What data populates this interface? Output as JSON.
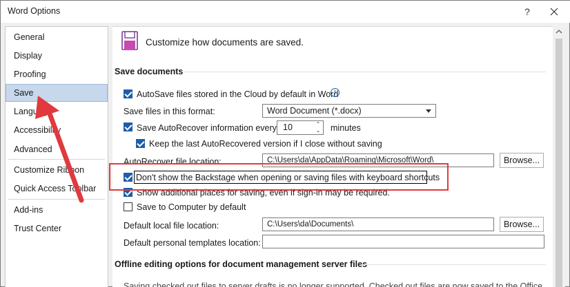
{
  "window": {
    "title": "Word Options",
    "help": "?"
  },
  "sidebar": {
    "items": [
      {
        "label": "General"
      },
      {
        "label": "Display"
      },
      {
        "label": "Proofing"
      },
      {
        "label": "Save"
      },
      {
        "label": "Language"
      },
      {
        "label": "Accessibility"
      },
      {
        "label": "Advanced"
      },
      {
        "label": "Customize Ribbon"
      },
      {
        "label": "Quick Access Toolbar"
      },
      {
        "label": "Add-ins"
      },
      {
        "label": "Trust Center"
      }
    ],
    "selected": "Save"
  },
  "main": {
    "header": "Customize how documents are saved.",
    "save_section": {
      "title": "Save documents",
      "autosave_label": "AutoSave files stored in the Cloud by default in Word",
      "autosave_checked": true,
      "format_label": "Save files in this format:",
      "format_value": "Word Document (*.docx)",
      "autorecover_label": "Save AutoRecover information every",
      "autorecover_checked": true,
      "autorecover_value": "10",
      "minutes_label": "minutes",
      "keep_last_label": "Keep the last AutoRecovered version if I close without saving",
      "keep_last_checked": true,
      "autorecover_location_label": "AutoRecover file location:",
      "autorecover_location_value": "C:\\Users\\da\\AppData\\Roaming\\Microsoft\\Word\\",
      "browse_label": "Browse...",
      "backstage_label": "Don't show the Backstage when opening or saving files with keyboard shortcuts",
      "backstage_checked": true,
      "additional_places_label": "Show additional places for saving, even if sign-in may be required.",
      "additional_places_checked": true,
      "save_computer_label": "Save to Computer by default",
      "save_computer_checked": false,
      "default_local_label": "Default local file location:",
      "default_local_value": "C:\\Users\\da\\Documents\\",
      "default_templates_label": "Default personal templates location:",
      "default_templates_value": ""
    },
    "offline_section": {
      "title": "Offline editing options for document management server files",
      "text": "Saving checked out files to server drafts is no longer supported. Checked out files are now saved to the Office"
    }
  },
  "colors": {
    "accent": "#1d5ea8",
    "highlight": "#e0393e",
    "selected_nav": "#c7d8ec"
  }
}
